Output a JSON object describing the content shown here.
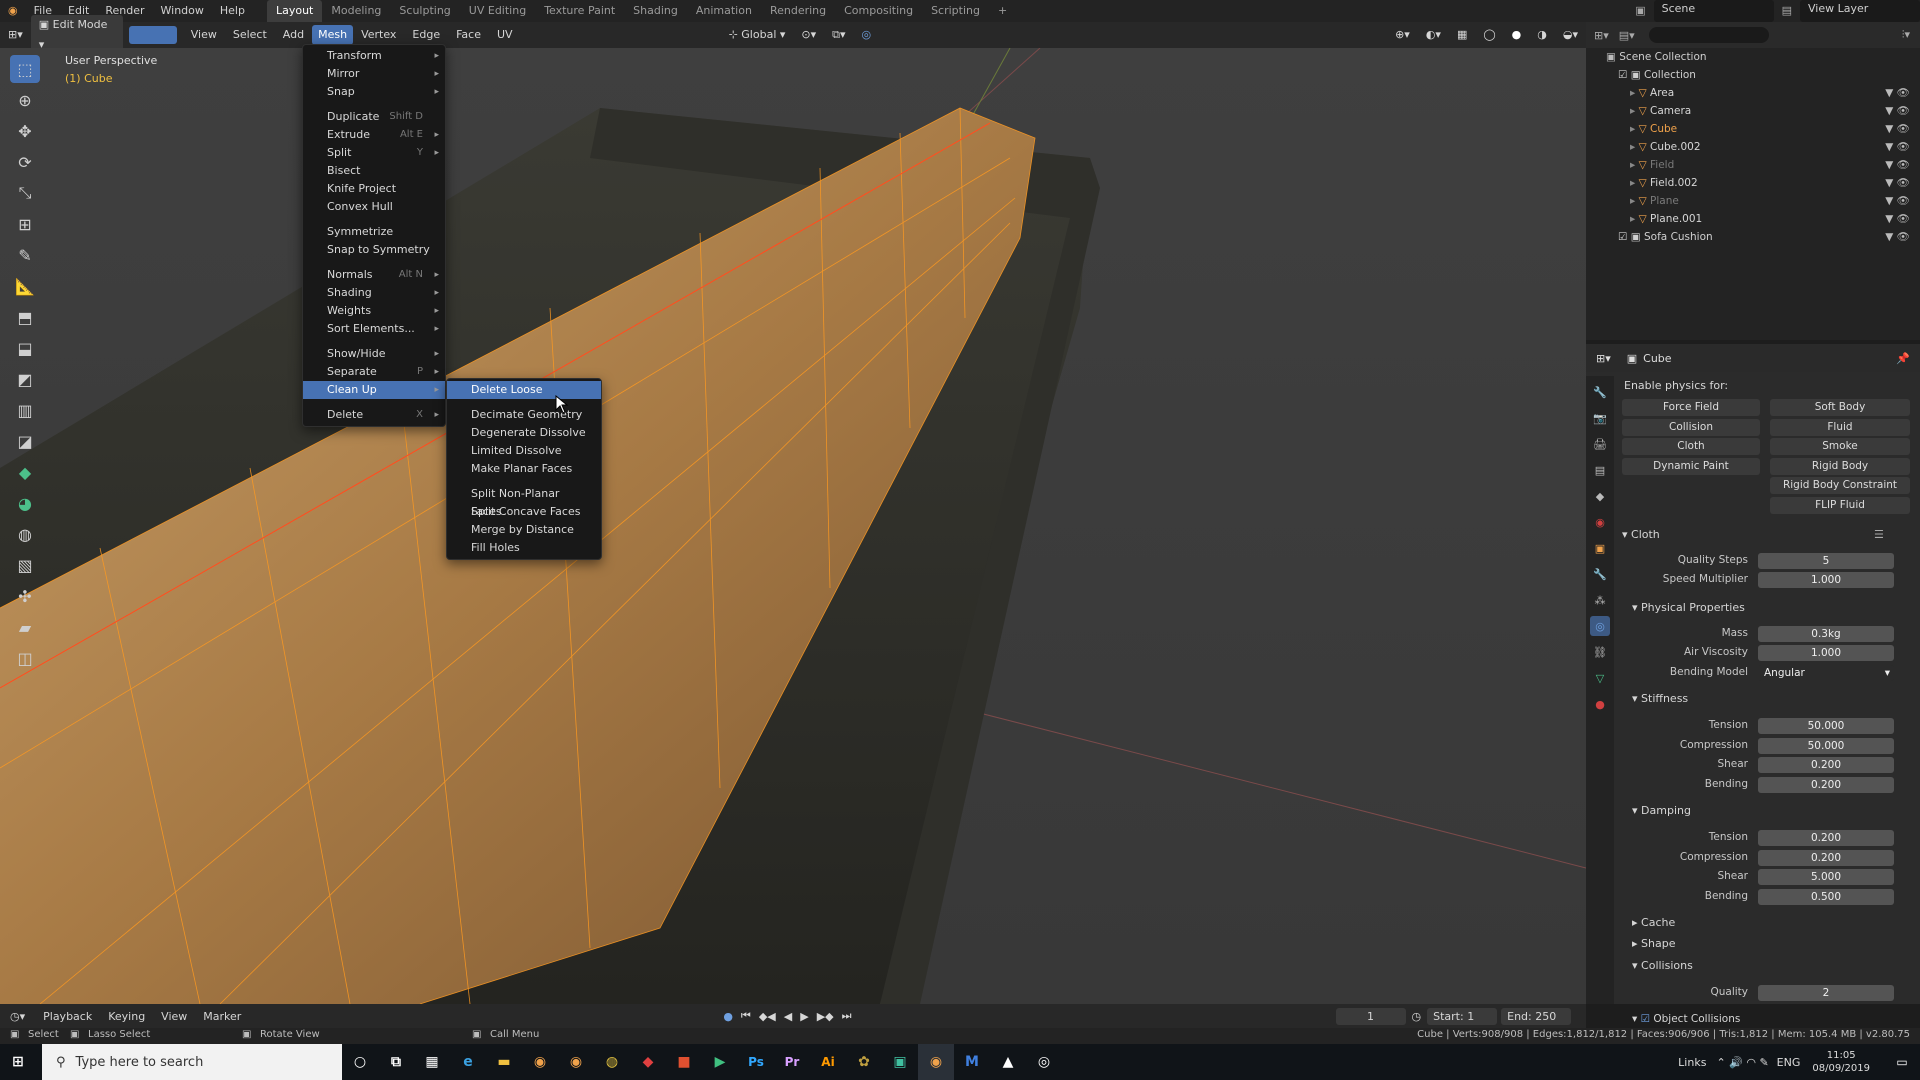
{
  "top_menu": [
    "File",
    "Edit",
    "Render",
    "Window",
    "Help"
  ],
  "workspaces": [
    {
      "label": "Layout",
      "active": true
    },
    {
      "label": "Modeling"
    },
    {
      "label": "Sculpting"
    },
    {
      "label": "UV Editing"
    },
    {
      "label": "Texture Paint"
    },
    {
      "label": "Shading"
    },
    {
      "label": "Animation"
    },
    {
      "label": "Rendering"
    },
    {
      "label": "Compositing"
    },
    {
      "label": "Scripting"
    }
  ],
  "scene_label": "Scene",
  "view_layer_label": "View Layer",
  "viewport_header": {
    "mode": "Edit Mode",
    "menus": [
      "View",
      "Select",
      "Add",
      "Mesh",
      "Vertex",
      "Edge",
      "Face",
      "UV"
    ],
    "active_menu": "Mesh",
    "transform_orientation": "Global"
  },
  "viewport": {
    "view_name": "User Perspective",
    "object_name": "(1) Cube"
  },
  "mesh_menu": [
    {
      "label": "Transform",
      "arrow": true
    },
    {
      "label": "Mirror",
      "arrow": true
    },
    {
      "label": "Snap",
      "arrow": true
    },
    {
      "sep": true
    },
    {
      "label": "Duplicate",
      "shortcut": "Shift D"
    },
    {
      "label": "Extrude",
      "shortcut": "Alt E",
      "arrow": true
    },
    {
      "label": "Split",
      "shortcut": "Y",
      "arrow": true
    },
    {
      "label": "Bisect"
    },
    {
      "label": "Knife Project"
    },
    {
      "label": "Convex Hull"
    },
    {
      "sep": true
    },
    {
      "label": "Symmetrize"
    },
    {
      "label": "Snap to Symmetry"
    },
    {
      "sep": true
    },
    {
      "label": "Normals",
      "shortcut": "Alt N",
      "arrow": true
    },
    {
      "label": "Shading",
      "arrow": true
    },
    {
      "label": "Weights",
      "arrow": true
    },
    {
      "label": "Sort Elements...",
      "arrow": true
    },
    {
      "sep": true
    },
    {
      "label": "Show/Hide",
      "arrow": true
    },
    {
      "label": "Separate",
      "shortcut": "P",
      "arrow": true
    },
    {
      "label": "Clean Up",
      "arrow": true,
      "highlight": true
    },
    {
      "sep": true
    },
    {
      "label": "Delete",
      "shortcut": "X",
      "arrow": true
    }
  ],
  "cleanup_menu": [
    {
      "label": "Delete Loose",
      "highlight": true
    },
    {
      "sep": true
    },
    {
      "label": "Decimate Geometry"
    },
    {
      "label": "Degenerate Dissolve"
    },
    {
      "label": "Limited Dissolve"
    },
    {
      "label": "Make Planar Faces"
    },
    {
      "sep": true
    },
    {
      "label": "Split Non-Planar Faces"
    },
    {
      "label": "Split Concave Faces"
    },
    {
      "label": "Merge by Distance"
    },
    {
      "label": "Fill Holes"
    }
  ],
  "outliner": {
    "scene_collection": "Scene Collection",
    "collection": "Collection",
    "items": [
      {
        "name": "Area",
        "color": "#d6d6d6"
      },
      {
        "name": "Camera",
        "color": "#d6d6d6"
      },
      {
        "name": "Cube",
        "color": "#f0a24b"
      },
      {
        "name": "Cube.002",
        "color": "#d6d6d6"
      },
      {
        "name": "Field",
        "color": "#7a7a7a"
      },
      {
        "name": "Field.002",
        "color": "#d6d6d6"
      },
      {
        "name": "Plane",
        "color": "#7a7a7a"
      },
      {
        "name": "Plane.001",
        "color": "#d6d6d6"
      }
    ],
    "sofa": "Sofa Cushion"
  },
  "properties": {
    "object_name": "Cube",
    "enable_physics": "Enable physics for:",
    "physics_left": [
      "Force Field",
      "Collision",
      "Cloth",
      "Dynamic Paint"
    ],
    "physics_right": [
      "Soft Body",
      "Fluid",
      "Smoke",
      "Rigid Body",
      "Rigid Body Constraint",
      "FLIP Fluid"
    ],
    "cloth_title": "Cloth",
    "quality_steps_label": "Quality Steps",
    "quality_steps": "5",
    "speed_mult_label": "Speed Multiplier",
    "speed_mult": "1.000",
    "physical_title": "Physical Properties",
    "mass_label": "Mass",
    "mass": "0.3kg",
    "air_visc_label": "Air Viscosity",
    "air_visc": "1.000",
    "bending_model_label": "Bending Model",
    "bending_model": "Angular",
    "stiffness_title": "Stiffness",
    "stiffness": [
      {
        "label": "Tension",
        "value": "50.000"
      },
      {
        "label": "Compression",
        "value": "50.000"
      },
      {
        "label": "Shear",
        "value": "0.200"
      },
      {
        "label": "Bending",
        "value": "0.200"
      }
    ],
    "damping_title": "Damping",
    "damping": [
      {
        "label": "Tension",
        "value": "0.200"
      },
      {
        "label": "Compression",
        "value": "0.200"
      },
      {
        "label": "Shear",
        "value": "5.000"
      },
      {
        "label": "Bending",
        "value": "0.500"
      }
    ],
    "cache": "Cache",
    "shape": "Shape",
    "collisions": "Collisions",
    "quality_label": "Quality",
    "quality": "2",
    "object_collisions": "Object Collisions"
  },
  "timeline": {
    "menus": [
      "Playback",
      "Keying",
      "View",
      "Marker"
    ],
    "current_frame": "1",
    "start_label": "Start:",
    "start": "1",
    "end_label": "End:",
    "end": "250"
  },
  "statusbar": {
    "select": "Select",
    "lasso": "Lasso Select",
    "rotate": "Rotate View",
    "call_menu": "Call Menu",
    "stats": "Cube | Verts:908/908 | Edges:1,812/1,812 | Faces:906/906 | Tris:1,812 | Mem: 105.4 MB | v2.80.75"
  },
  "taskbar": {
    "search_placeholder": "Type here to search",
    "links": "Links",
    "lang": "ENG",
    "time": "11:05",
    "date": "08/09/2019"
  }
}
